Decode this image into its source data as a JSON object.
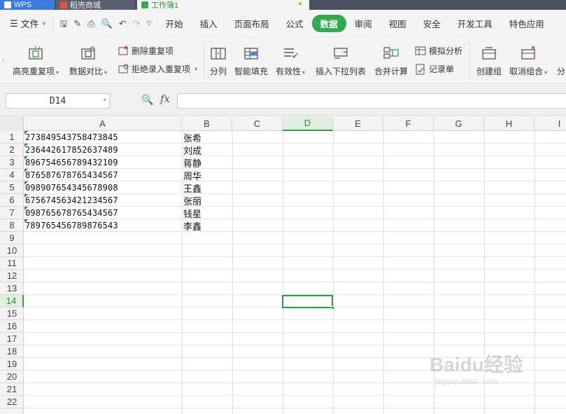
{
  "titlebar": {
    "tabs": [
      {
        "label": "WPS"
      },
      {
        "label": "稻壳商城"
      },
      {
        "label": "工作簿1"
      }
    ]
  },
  "menubar": {
    "file_label": "文件",
    "tabs": [
      "开始",
      "插入",
      "页面布局",
      "公式",
      "数据",
      "审阅",
      "视图",
      "安全",
      "开发工具",
      "特色应用"
    ],
    "active_tab": "数据"
  },
  "ribbon": {
    "highlight_duplicates": "高亮重复项",
    "data_compare": "数据对比",
    "remove_duplicates": "删除重复项",
    "reject_duplicates": "拒绝录入重复项",
    "split_column": "分列",
    "smart_fill": "智能填充",
    "validity": "有效性",
    "insert_dropdown": "插入下拉列表",
    "merge_calc": "合并计算",
    "simulation": "模拟分析",
    "record_list": "记录单",
    "create_group": "创建组",
    "ungroup": "取消组合",
    "subtotal": "分"
  },
  "formula_bar": {
    "name_box": "D14",
    "fx": "fx",
    "formula": ""
  },
  "sheet": {
    "columns": [
      "A",
      "B",
      "C",
      "D",
      "E",
      "F",
      "G",
      "H",
      "I"
    ],
    "selected_column": "D",
    "selected_row": 14,
    "rows": [
      "1",
      "2",
      "3",
      "4",
      "5",
      "6",
      "7",
      "8",
      "9",
      "10",
      "11",
      "12",
      "13",
      "14",
      "15",
      "16",
      "17",
      "18",
      "19",
      "20",
      "21",
      "22"
    ],
    "data": [
      {
        "a": "273849543758473845",
        "b": "张希"
      },
      {
        "a": "236442617852637489",
        "b": "刘成"
      },
      {
        "a": "896754656789432109",
        "b": "蒋静"
      },
      {
        "a": "876587678765434567",
        "b": "周华"
      },
      {
        "a": "098907654345678908",
        "b": "王鑫"
      },
      {
        "a": "675674563421234567",
        "b": "张丽"
      },
      {
        "a": "098765678765434567",
        "b": "钱星"
      },
      {
        "a": "789765456789876543",
        "b": "李鑫"
      }
    ]
  },
  "watermark": {
    "brand": "Baidu经验",
    "url": "jingyan.baidu.com"
  },
  "colors": {
    "accent": "#34a853",
    "selection": "#2f9a3f",
    "wps_tab": "#3b7be0"
  }
}
